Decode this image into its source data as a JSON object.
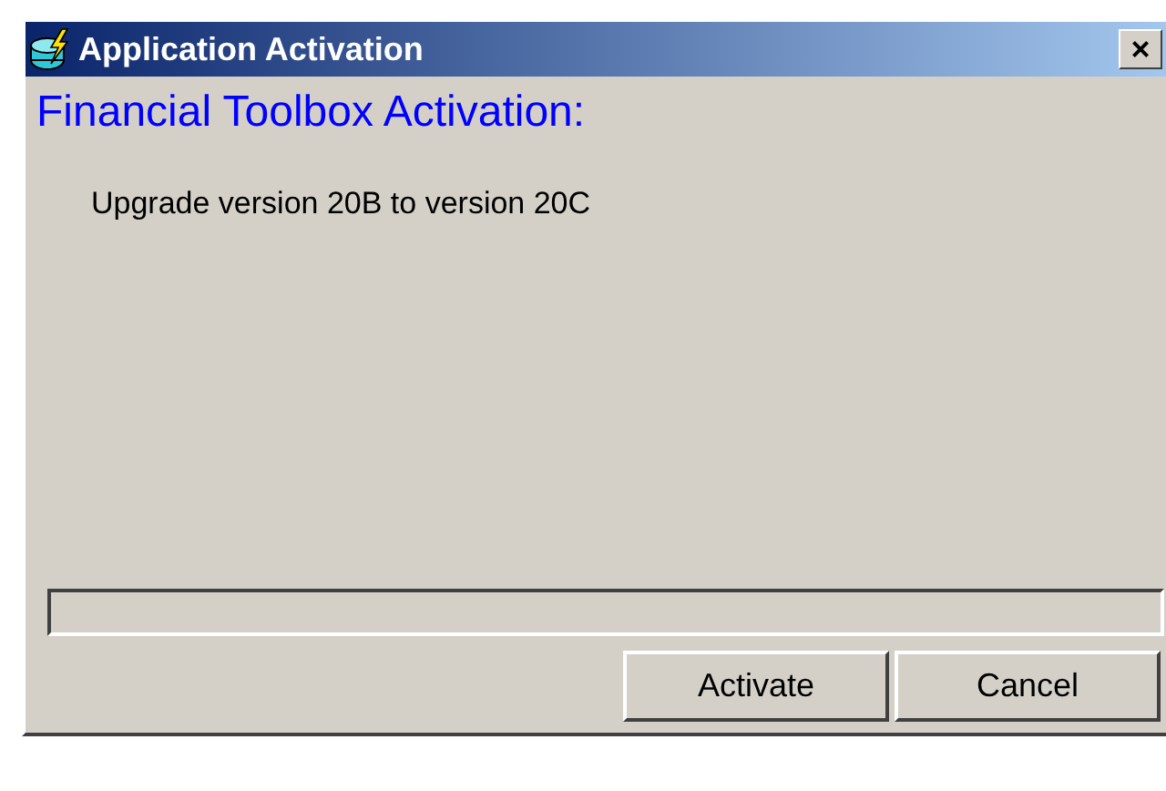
{
  "window": {
    "title": "Application Activation",
    "close": "×"
  },
  "heading": "Financial Toolbox Activation:",
  "message": "Upgrade version 20B to version 20C",
  "progress": {
    "level": 0
  },
  "buttons": [
    {
      "label": "Activate"
    },
    {
      "label": "Cancel"
    }
  ]
}
